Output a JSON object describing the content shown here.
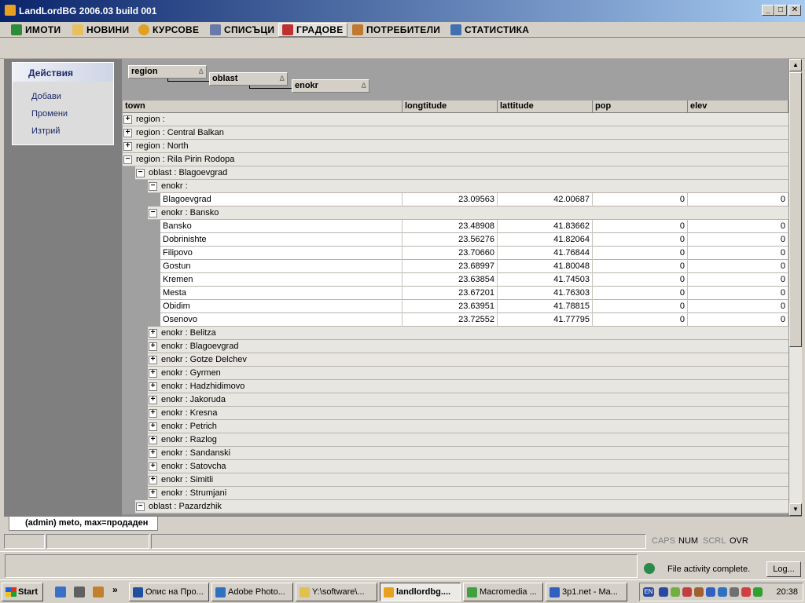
{
  "window": {
    "title": "LandLordBG 2006.03 build 001",
    "min": "_",
    "max": "□",
    "close": "✕"
  },
  "tabs": [
    {
      "label": "ИМОТИ",
      "color": "#2e8b3a"
    },
    {
      "label": "НОВИНИ",
      "color": "#e8c060"
    },
    {
      "label": "КУРСОВЕ",
      "color": "#e0a020"
    },
    {
      "label": "СПИСЪЦИ",
      "color": "#6a7aa8"
    },
    {
      "label": "ГРАДОВЕ",
      "color": "#c03030",
      "active": true
    },
    {
      "label": "ПОТРЕБИТЕЛИ",
      "color": "#c07a30"
    },
    {
      "label": "СТАТИСТИКА",
      "color": "#4070b0"
    }
  ],
  "actions": {
    "header": "Действия",
    "items": [
      "Добави",
      "Промени",
      "Изтрий"
    ]
  },
  "grouping": {
    "level1": "region",
    "level2": "oblast",
    "level3": "enokr",
    "sort_glyph": "Δ"
  },
  "columns": [
    "town",
    "longtitude",
    "lattitude",
    "pop",
    "elev"
  ],
  "rows": [
    {
      "kind": "group",
      "level": 0,
      "expanded": false,
      "text": "region :"
    },
    {
      "kind": "group",
      "level": 0,
      "expanded": false,
      "text": "region : Central Balkan"
    },
    {
      "kind": "group",
      "level": 0,
      "expanded": false,
      "text": "region : North"
    },
    {
      "kind": "group",
      "level": 0,
      "expanded": true,
      "text": "region : Rila Pirin Rodopa"
    },
    {
      "kind": "group",
      "level": 1,
      "expanded": true,
      "text": "oblast : Blagoevgrad"
    },
    {
      "kind": "group",
      "level": 2,
      "expanded": true,
      "text": "enokr :"
    },
    {
      "kind": "data",
      "town": "Blagoevgrad",
      "lon": "23.09563",
      "lat": "42.00687",
      "pop": "0",
      "elev": "0"
    },
    {
      "kind": "group",
      "level": 2,
      "expanded": true,
      "text": "enokr : Bansko"
    },
    {
      "kind": "data",
      "town": "Bansko",
      "lon": "23.48908",
      "lat": "41.83662",
      "pop": "0",
      "elev": "0"
    },
    {
      "kind": "data",
      "town": "Dobrinishte",
      "lon": "23.56276",
      "lat": "41.82064",
      "pop": "0",
      "elev": "0"
    },
    {
      "kind": "data",
      "town": "Filipovo",
      "lon": "23.70660",
      "lat": "41.76844",
      "pop": "0",
      "elev": "0"
    },
    {
      "kind": "data",
      "town": "Gostun",
      "lon": "23.68997",
      "lat": "41.80048",
      "pop": "0",
      "elev": "0"
    },
    {
      "kind": "data",
      "town": "Kremen",
      "lon": "23.63854",
      "lat": "41.74503",
      "pop": "0",
      "elev": "0"
    },
    {
      "kind": "data",
      "town": "Mesta",
      "lon": "23.67201",
      "lat": "41.76303",
      "pop": "0",
      "elev": "0"
    },
    {
      "kind": "data",
      "town": "Obidim",
      "lon": "23.63951",
      "lat": "41.78815",
      "pop": "0",
      "elev": "0"
    },
    {
      "kind": "data",
      "town": "Osenovo",
      "lon": "23.72552",
      "lat": "41.77795",
      "pop": "0",
      "elev": "0"
    },
    {
      "kind": "group",
      "level": 2,
      "expanded": false,
      "text": "enokr : Belitza"
    },
    {
      "kind": "group",
      "level": 2,
      "expanded": false,
      "text": "enokr : Blagoevgrad"
    },
    {
      "kind": "group",
      "level": 2,
      "expanded": false,
      "text": "enokr : Gotze Delchev"
    },
    {
      "kind": "group",
      "level": 2,
      "expanded": false,
      "text": "enokr : Gyrmen"
    },
    {
      "kind": "group",
      "level": 2,
      "expanded": false,
      "text": "enokr : Hadzhidimovo"
    },
    {
      "kind": "group",
      "level": 2,
      "expanded": false,
      "text": "enokr : Jakoruda"
    },
    {
      "kind": "group",
      "level": 2,
      "expanded": false,
      "text": "enokr : Kresna"
    },
    {
      "kind": "group",
      "level": 2,
      "expanded": false,
      "text": "enokr : Petrich"
    },
    {
      "kind": "group",
      "level": 2,
      "expanded": false,
      "text": "enokr : Razlog"
    },
    {
      "kind": "group",
      "level": 2,
      "expanded": false,
      "text": "enokr : Sandanski"
    },
    {
      "kind": "group",
      "level": 2,
      "expanded": false,
      "text": "enokr : Satovcha"
    },
    {
      "kind": "group",
      "level": 2,
      "expanded": false,
      "text": "enokr : Simitli"
    },
    {
      "kind": "group",
      "level": 2,
      "expanded": false,
      "text": "enokr : Strumjani"
    },
    {
      "kind": "group",
      "level": 1,
      "expanded": true,
      "text": "oblast : Pazardzhik"
    }
  ],
  "bottom_tab": "(admin) meto, max=продаден",
  "status": {
    "keys": [
      "CAPS",
      "NUM",
      "SCRL",
      "OVR"
    ],
    "active_keys": [
      "NUM",
      "OVR"
    ]
  },
  "browser": {
    "status_text": "File activity complete.",
    "log_button": "Log..."
  },
  "taskbar": {
    "start": "Start",
    "more": "»",
    "tasks": [
      {
        "label": "Опис на Про...",
        "color": "#2050a0"
      },
      {
        "label": "Adobe Photo...",
        "color": "#3070c0"
      },
      {
        "label": "Y:\\software\\...",
        "color": "#e0c050"
      },
      {
        "label": "landlordbg....",
        "color": "#e8a020",
        "active": true
      },
      {
        "label": "Macromedia ...",
        "color": "#40a040"
      },
      {
        "label": "3p1.net - Ma...",
        "color": "#3060c0"
      }
    ],
    "quick_launch": [
      "#3a70c8",
      "#606060",
      "#c08030"
    ],
    "tray_icons": [
      "#2a4aa0",
      "#70b040",
      "#c04040",
      "#a06030",
      "#3060c0",
      "#3070c0",
      "#707070",
      "#d04040",
      "#30a030"
    ],
    "lang": "EN",
    "clock": "20:38"
  }
}
